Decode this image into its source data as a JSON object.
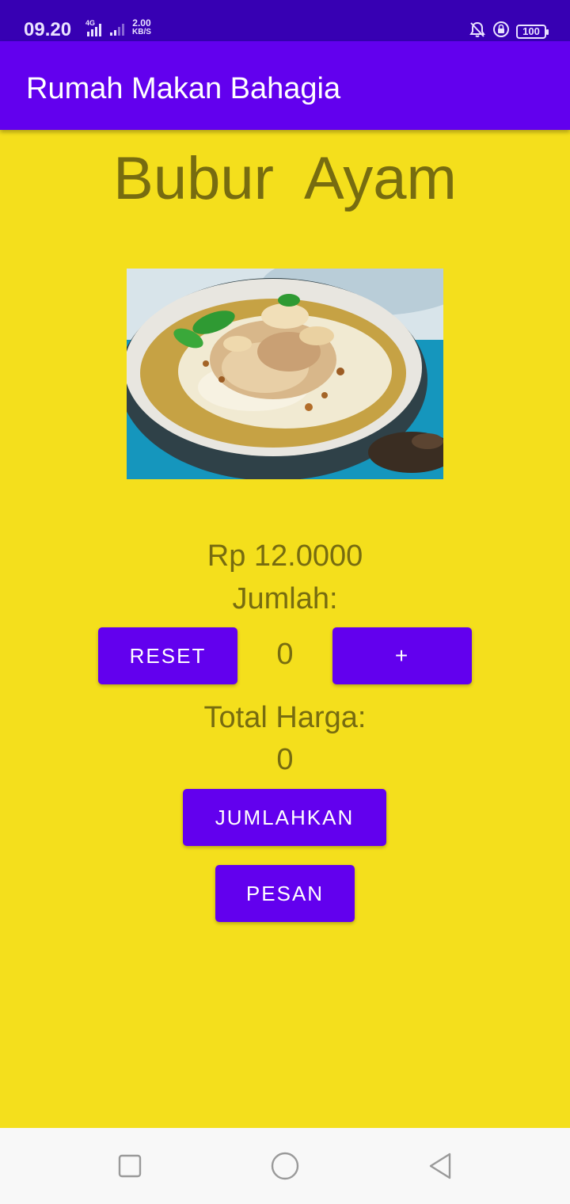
{
  "status_bar": {
    "time": "09.20",
    "network_type": "4G",
    "speed_value": "2.00",
    "speed_unit": "KB/S",
    "battery": "100",
    "icons": [
      "signal-icon",
      "signal-icon",
      "mute-bell-icon",
      "rotation-lock-icon",
      "battery-icon"
    ]
  },
  "app_bar": {
    "title": "Rumah Makan Bahagia"
  },
  "main": {
    "dish_name": "Bubur  Ayam",
    "image_alt": "bubur ayam dish photo",
    "price": "Rp 12.0000",
    "quantity_label": "Jumlah:",
    "quantity_value": "0",
    "reset_label": "RESET",
    "plus_label": "+",
    "total_label": "Total Harga:",
    "total_value": "0",
    "sum_label": "JUMLAHKAN",
    "order_label": "PESAN"
  },
  "nav_bar": {
    "icons": [
      "recent-apps-icon",
      "home-icon",
      "back-icon"
    ]
  },
  "colors": {
    "background": "#f4df1c",
    "app_bar": "#6200ee",
    "status_bar": "#3700b3",
    "button": "#6200ee",
    "text": "#776c10"
  }
}
